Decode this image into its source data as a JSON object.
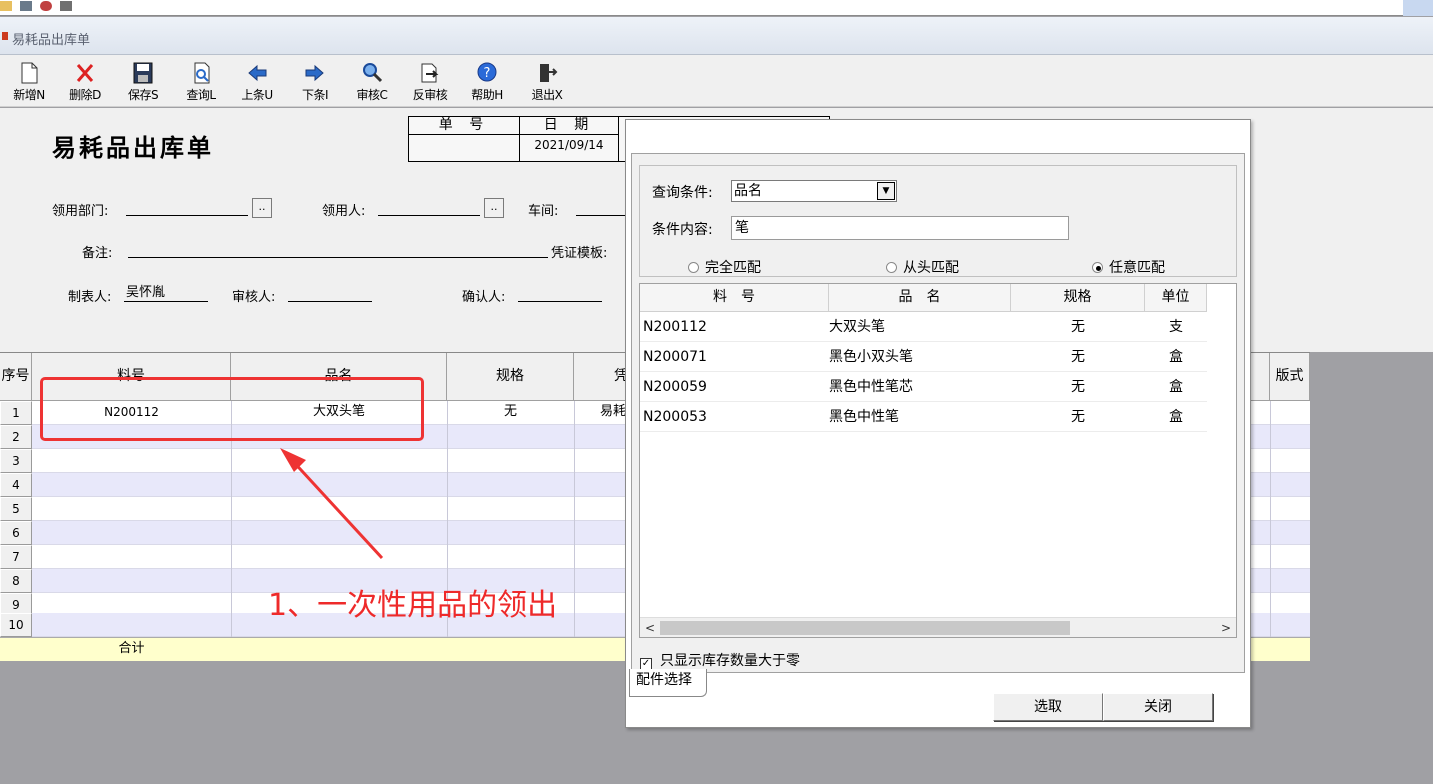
{
  "window": {
    "title": "易耗品出库单"
  },
  "toolbar": {
    "new": "新增N",
    "delete": "删除D",
    "save": "保存S",
    "query": "查询L",
    "prev": "上条U",
    "next": "下条I",
    "audit": "审核C",
    "unaudit": "反审核",
    "help": "帮助H",
    "exit": "退出X"
  },
  "form": {
    "title": "易耗品出库单",
    "doc_no_label": "单 号",
    "doc_no_value": "",
    "date_label": "日 期",
    "date_value": "2021/09/14",
    "dept_label": "领用部门:",
    "dept_value": "",
    "receiver_label": "领用人:",
    "receiver_value": "",
    "workshop_label": "车间:",
    "workshop_value": "",
    "remark_label": "备注:",
    "remark_value": "",
    "voucher_label": "凭证模板:",
    "maker_label": "制表人:",
    "maker_value": "吴怀胤",
    "auditor_label": "审核人:",
    "auditor_value": "",
    "confirmer_label": "确认人:",
    "confirmer_value": "",
    "lookup_button": ".."
  },
  "grid": {
    "headers": {
      "seq": "序号",
      "code": "料号",
      "name": "品名",
      "spec": "规格",
      "col5": "凭",
      "format": "版式"
    },
    "rows": [
      {
        "seq": "1",
        "code": "N200112",
        "name": "大双头笔",
        "spec": "无",
        "col5": "易耗"
      },
      {
        "seq": "2",
        "code": "",
        "name": "",
        "spec": "",
        "col5": ""
      },
      {
        "seq": "3",
        "code": "",
        "name": "",
        "spec": "",
        "col5": ""
      },
      {
        "seq": "4",
        "code": "",
        "name": "",
        "spec": "",
        "col5": ""
      },
      {
        "seq": "5",
        "code": "",
        "name": "",
        "spec": "",
        "col5": ""
      },
      {
        "seq": "6",
        "code": "",
        "name": "",
        "spec": "",
        "col5": ""
      },
      {
        "seq": "7",
        "code": "",
        "name": "",
        "spec": "",
        "col5": ""
      },
      {
        "seq": "8",
        "code": "",
        "name": "",
        "spec": "",
        "col5": ""
      },
      {
        "seq": "9",
        "code": "",
        "name": "",
        "spec": "",
        "col5": ""
      },
      {
        "seq": "10",
        "code": "",
        "name": "",
        "spec": "",
        "col5": ""
      }
    ],
    "total_label": "合计"
  },
  "annotation": {
    "text": "1、一次性用品的领出",
    "color": "#ee2a2a"
  },
  "dialog": {
    "query_condition_label": "查询条件:",
    "query_condition_value": "品名",
    "query_content_label": "条件内容:",
    "query_content_value": "笔",
    "match_options": [
      "完全匹配",
      "从头匹配",
      "任意匹配"
    ],
    "match_selected": "任意匹配",
    "columns": {
      "code": "料　号",
      "name": "品　名",
      "spec": "规格",
      "unit": "单位"
    },
    "rows": [
      {
        "code": "N200112",
        "name": "大双头笔",
        "spec": "无",
        "unit": "支"
      },
      {
        "code": "N200071",
        "name": "黑色小双头笔",
        "spec": "无",
        "unit": "盒"
      },
      {
        "code": "N200059",
        "name": "黑色中性笔芯",
        "spec": "无",
        "unit": "盒"
      },
      {
        "code": "N200053",
        "name": "黑色中性笔",
        "spec": "无",
        "unit": "盒"
      }
    ],
    "only_positive_stock_label": "只显示库存数量大于零",
    "only_positive_stock_checked": true,
    "tab_label": "配件选择",
    "select_button": "选取",
    "close_button": "关闭"
  }
}
